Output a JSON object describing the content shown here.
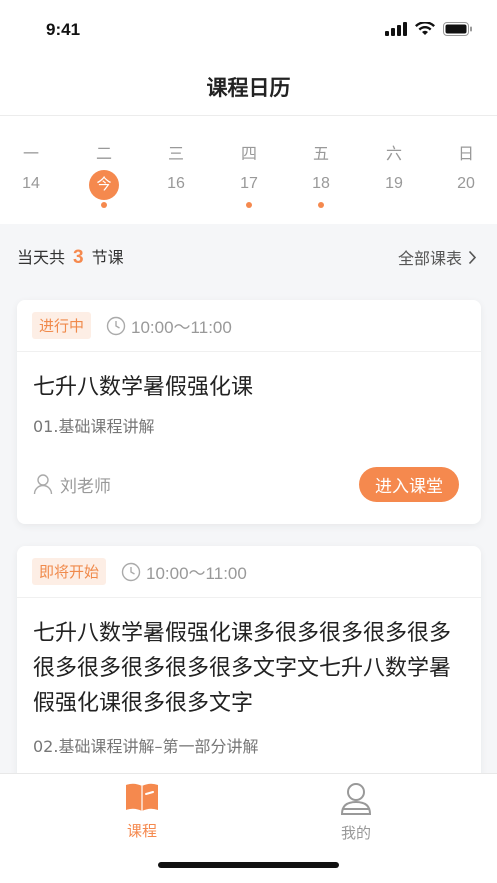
{
  "status": {
    "time": "9:41"
  },
  "header": {
    "title": "课程日历"
  },
  "calendar": {
    "days": [
      {
        "weekday": "一",
        "date": "14",
        "today": false,
        "has_class": false
      },
      {
        "weekday": "二",
        "date": "今",
        "today": true,
        "has_class": true
      },
      {
        "weekday": "三",
        "date": "16",
        "today": false,
        "has_class": false
      },
      {
        "weekday": "四",
        "date": "17",
        "today": false,
        "has_class": true
      },
      {
        "weekday": "五",
        "date": "18",
        "today": false,
        "has_class": true
      },
      {
        "weekday": "六",
        "date": "19",
        "today": false,
        "has_class": false
      },
      {
        "weekday": "日",
        "date": "20",
        "today": false,
        "has_class": false
      }
    ]
  },
  "summary": {
    "prefix": "当天共",
    "count": "3",
    "suffix": "节课",
    "all_schedule": "全部课表"
  },
  "courses": [
    {
      "status": "进行中",
      "time": "10:00～11:00",
      "title": "七升八数学暑假强化课",
      "lesson": "01.基础课程讲解",
      "teacher": "刘老师",
      "action": "进入课堂"
    },
    {
      "status": "即将开始",
      "time": "10:00～11:00",
      "title": "七升八数学暑假强化课多很多很多很多很多很多很多很多很多很多文字文七升八数学暑假强化课很多很多文字",
      "lesson": "02.基础课程讲解–第一部分讲解"
    }
  ],
  "tabbar": {
    "courses": "课程",
    "mine": "我的"
  },
  "colors": {
    "accent": "#f5894e",
    "badge_bg": "#fdeee5"
  }
}
